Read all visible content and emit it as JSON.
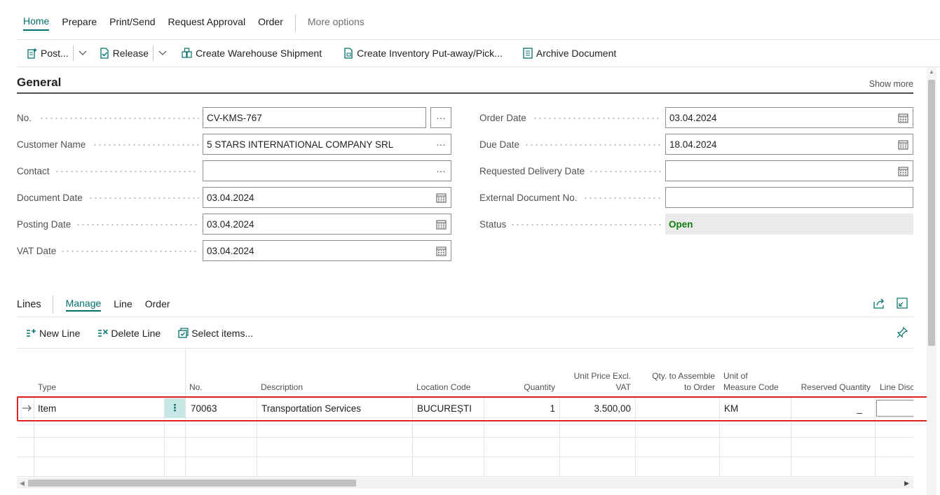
{
  "menu": {
    "items": [
      "Home",
      "Prepare",
      "Print/Send",
      "Request Approval",
      "Order"
    ],
    "more": "More options"
  },
  "toolbar": {
    "post": "Post...",
    "release": "Release",
    "create_shipment": "Create Warehouse Shipment",
    "create_putaway": "Create Inventory Put-away/Pick...",
    "archive": "Archive Document"
  },
  "general": {
    "title": "General",
    "show_more": "Show more",
    "no_label": "No.",
    "no_value": "CV-KMS-767",
    "customer_label": "Customer Name",
    "customer_value": "5 STARS INTERNATIONAL COMPANY SRL",
    "contact_label": "Contact",
    "contact_value": "",
    "docdate_label": "Document Date",
    "docdate_value": "03.04.2024",
    "postdate_label": "Posting Date",
    "postdate_value": "03.04.2024",
    "vatdate_label": "VAT Date",
    "vatdate_value": "03.04.2024",
    "orderdate_label": "Order Date",
    "orderdate_value": "03.04.2024",
    "duedate_label": "Due Date",
    "duedate_value": "18.04.2024",
    "reqdel_label": "Requested Delivery Date",
    "reqdel_value": "",
    "extdoc_label": "External Document No.",
    "extdoc_value": "",
    "status_label": "Status",
    "status_value": "Open"
  },
  "lines": {
    "title": "Lines",
    "tabs": [
      "Manage",
      "Line",
      "Order"
    ],
    "new_line": "New Line",
    "delete_line": "Delete Line",
    "select_items": "Select items...",
    "columns": {
      "type": "Type",
      "no": "No.",
      "description": "Description",
      "location": "Location Code",
      "quantity": "Quantity",
      "unit_price_1": "Unit Price Excl.",
      "unit_price_2": "VAT",
      "qty_assemble_1": "Qty. to Assemble",
      "qty_assemble_2": "to Order",
      "uom_1": "Unit of",
      "uom_2": "Measure Code",
      "reserved": "Reserved Quantity",
      "line_disc": "Line Disc"
    },
    "row": {
      "type": "Item",
      "no": "70063",
      "description": "Transportation Services",
      "location": "BUCUREȘTI",
      "quantity": "1",
      "unit_price": "3.500,00",
      "qty_assemble": "",
      "uom": "KM",
      "reserved": "_"
    }
  },
  "colors": {
    "accent": "#00706b",
    "status_open": "#107c10",
    "highlight_border": "#e32323"
  }
}
